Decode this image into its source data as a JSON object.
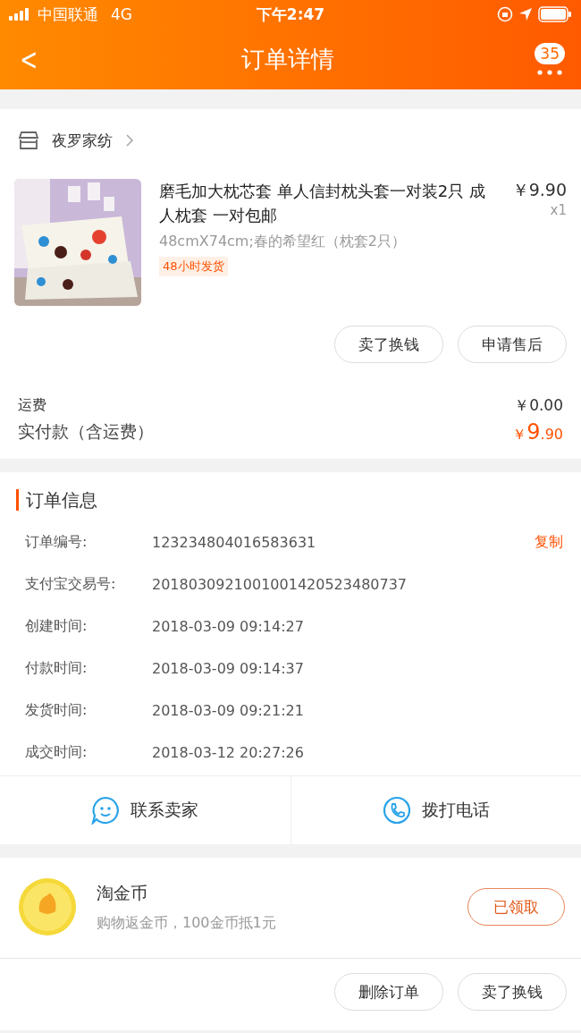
{
  "status_bar": {
    "carrier": "中国联通",
    "network": "4G",
    "time": "下午2:47"
  },
  "nav": {
    "back": "<",
    "title": "订单详情",
    "badge": "35"
  },
  "shop": {
    "name": "夜罗家纺"
  },
  "product": {
    "title": "磨毛加大枕芯套 单人信封枕头套一对装2只 成人枕套 一对包邮",
    "price": "￥9.90",
    "quantity": "x1",
    "sku": "48cmX74cm;春的希望红（枕套2只）",
    "tag": "48小时发货"
  },
  "item_actions": [
    "卖了换钱",
    "申请售后"
  ],
  "shipping": {
    "label": "运费",
    "value": "￥0.00"
  },
  "paid": {
    "label": "实付款（含运费）",
    "currency": "￥",
    "integer": "9",
    "decimal": ".90"
  },
  "order_info": {
    "title": "订单信息",
    "rows": [
      {
        "label": "订单编号:",
        "value": "123234804016583631",
        "action": "复制"
      },
      {
        "label": "支付宝交易号:",
        "value": "2018030921001001420523480737"
      },
      {
        "label": "创建时间:",
        "value": "2018-03-09 09:14:27"
      },
      {
        "label": "付款时间:",
        "value": "2018-03-09 09:14:37"
      },
      {
        "label": "发货时间:",
        "value": "2018-03-09 09:21:21"
      },
      {
        "label": "成交时间:",
        "value": "2018-03-12 20:27:26"
      }
    ]
  },
  "contact": [
    {
      "kind": "chat",
      "label": "联系卖家"
    },
    {
      "kind": "phone",
      "label": "拨打电话"
    }
  ],
  "coins": {
    "title": "淘金币",
    "subtitle": "购物返金币，100金币抵1元",
    "button": "已领取"
  },
  "footer_buttons": [
    "删除订单",
    "卖了换钱"
  ]
}
